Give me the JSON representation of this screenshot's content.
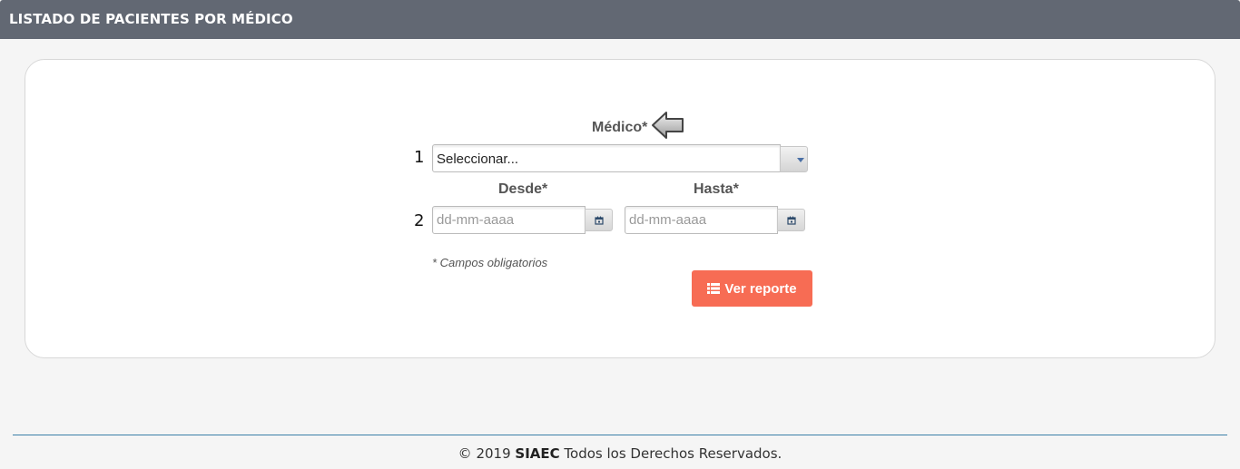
{
  "header": {
    "title": "LISTADO DE PACIENTES POR MÉDICO"
  },
  "form": {
    "medico": {
      "label": "Médico*",
      "row_number": "1",
      "selected": "Seleccionar..."
    },
    "desde": {
      "label": "Desde*",
      "placeholder": "dd-mm-aaaa",
      "row_number": "2"
    },
    "hasta": {
      "label": "Hasta*",
      "placeholder": "dd-mm-aaaa"
    },
    "required_hint": "* Campos obligatorios",
    "submit_label": "Ver reporte",
    "submit_color": "#f76c54"
  },
  "icons": {
    "pointer": "arrow-left-icon",
    "dropdown": "chevron-down-icon",
    "calendar": "calendar-icon",
    "report": "list-icon"
  },
  "footer": {
    "prefix": "© 2019 ",
    "brand": "SIAEC",
    "suffix": " Todos los Derechos Reservados."
  },
  "colors": {
    "header_bg": "#626873",
    "footer_line": "#3b7fa8"
  }
}
